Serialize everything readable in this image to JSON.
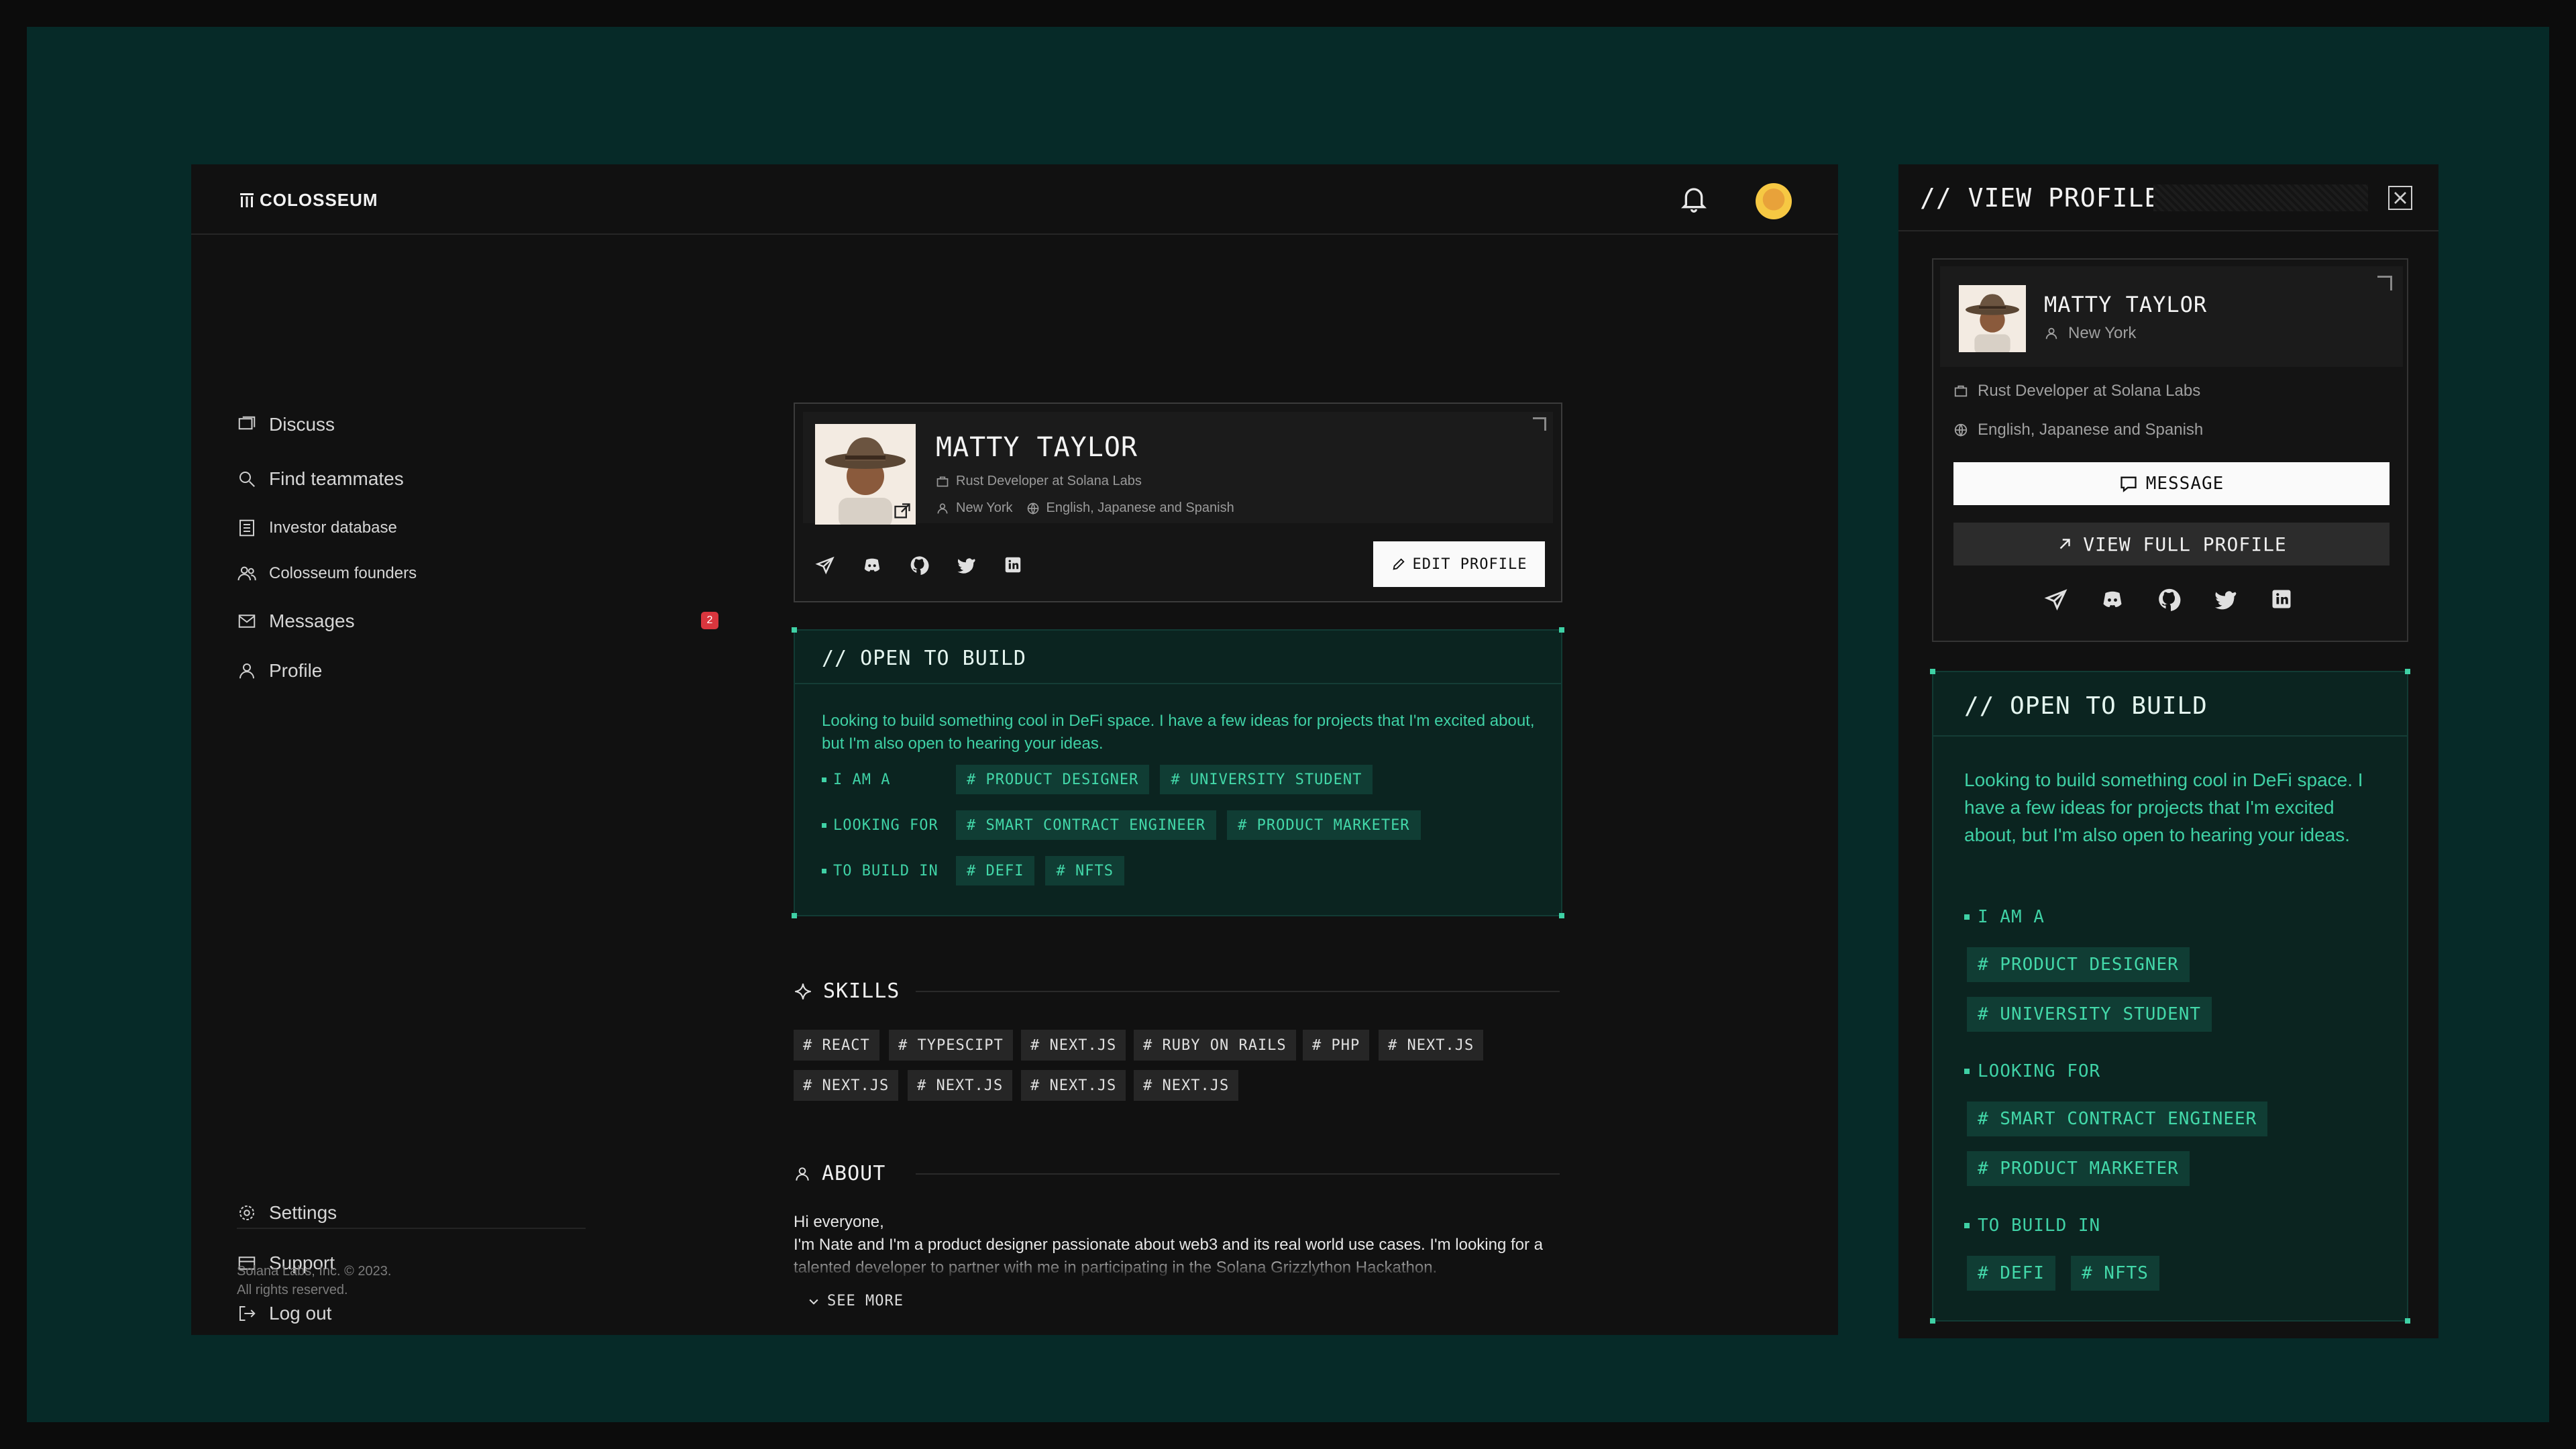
{
  "brand": {
    "name": "COLOSSEUM"
  },
  "nav": {
    "discuss": "Discuss",
    "find_teammates": "Find teammates",
    "investor_database": "Investor database",
    "colosseum_founders": "Colosseum founders",
    "messages": "Messages",
    "messages_badge": "2",
    "profile": "Profile",
    "settings": "Settings",
    "support": "Support",
    "logout": "Log out"
  },
  "footer": {
    "line1": "Solana Labs, Inc. © 2023.",
    "line2": "All rights reserved."
  },
  "profile": {
    "name": "MATTY TAYLOR",
    "role": "Rust Developer at Solana Labs",
    "location": "New York",
    "languages": "English, Japanese and Spanish",
    "edit_label": "EDIT PROFILE"
  },
  "open_to_build": {
    "title": "// OPEN TO BUILD",
    "description": "Looking to build something cool in DeFi space. I have a few ideas for projects that I'm excited about, but I'm also open to hearing your ideas.",
    "rows": [
      {
        "label": "I AM A",
        "tags": [
          "# PRODUCT DESIGNER",
          "# UNIVERSITY STUDENT"
        ]
      },
      {
        "label": "LOOKING FOR",
        "tags": [
          "# SMART CONTRACT ENGINEER",
          "# PRODUCT MARKETER"
        ]
      },
      {
        "label": "TO BUILD IN",
        "tags": [
          "# DEFI",
          "# NFTS"
        ]
      }
    ]
  },
  "skills": {
    "title": "SKILLS",
    "items": [
      "# REACT",
      "# TYPESCIPT",
      "# NEXT.JS",
      "# RUBY ON RAILS",
      "# PHP",
      "# NEXT.JS",
      "# NEXT.JS",
      "# NEXT.JS",
      "# NEXT.JS",
      "# NEXT.JS"
    ]
  },
  "about": {
    "title": "ABOUT",
    "greeting": "Hi everyone,",
    "text": "I'm Nate and I'm a product designer passionate about web3 and its real world use cases. I'm looking for a talented developer to partner with me in participating in the Solana Grizzlython Hackathon.",
    "see_more": "SEE MORE"
  },
  "panel": {
    "title": "// VIEW PROFILE",
    "message_label": "MESSAGE",
    "view_full_label": "VIEW FULL PROFILE"
  }
}
